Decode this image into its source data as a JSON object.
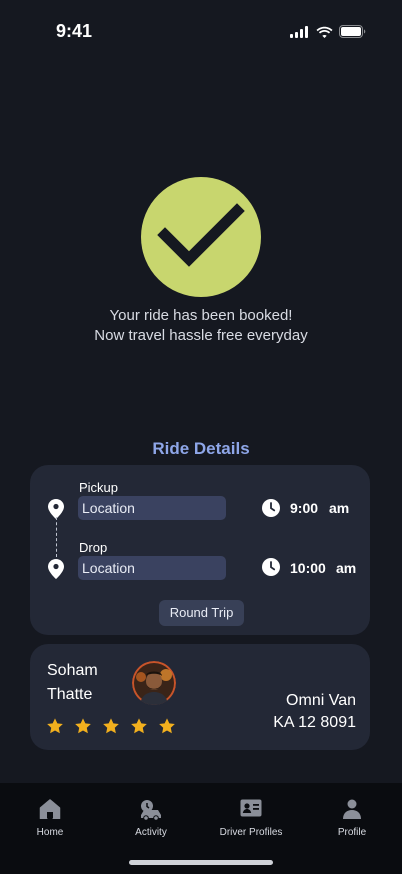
{
  "status_bar": {
    "time": "9:41"
  },
  "confirmation": {
    "line1": "Your ride has been booked!",
    "line2": "Now travel hassle free everyday"
  },
  "ride_details": {
    "title": "Ride Details",
    "pickup": {
      "label": "Pickup",
      "location": "Location",
      "time": "9:00",
      "period": "am"
    },
    "drop": {
      "label": "Drop",
      "location": "Location",
      "time": "10:00",
      "period": "am"
    },
    "trip_type": "Round Trip"
  },
  "driver": {
    "first_name": "Soham",
    "last_name": "Thatte",
    "rating": 5,
    "vehicle_model": "Omni Van",
    "vehicle_plate": "KA 12 8091"
  },
  "tabs": [
    {
      "label": "Home",
      "icon": "home-icon"
    },
    {
      "label": "Activity",
      "icon": "activity-icon"
    },
    {
      "label": "Driver Profiles",
      "icon": "id-card-icon"
    },
    {
      "label": "Profile",
      "icon": "person-icon"
    }
  ],
  "colors": {
    "background": "#151820",
    "card": "#232836",
    "accent_check": "#c8d66e",
    "title_blue": "#8ea6e8",
    "star": "#f2b01e"
  }
}
